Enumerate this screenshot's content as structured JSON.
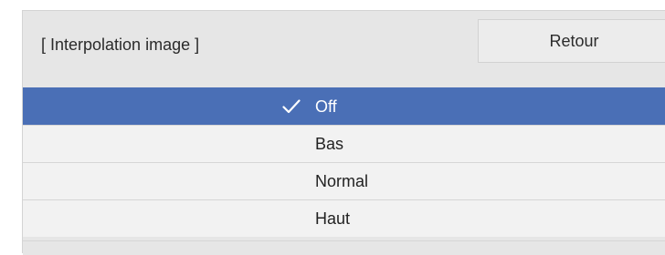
{
  "dialog": {
    "title": "[ Interpolation image ]",
    "back_label": "Retour"
  },
  "options": [
    {
      "label": "Off",
      "selected": true,
      "icon": "check-icon"
    },
    {
      "label": "Bas",
      "selected": false
    },
    {
      "label": "Normal",
      "selected": false
    },
    {
      "label": "Haut",
      "selected": false
    }
  ],
  "colors": {
    "selected_background": "#4a6fb6",
    "option_background": "#f2f2f2",
    "panel_background": "#e6e6e6"
  }
}
